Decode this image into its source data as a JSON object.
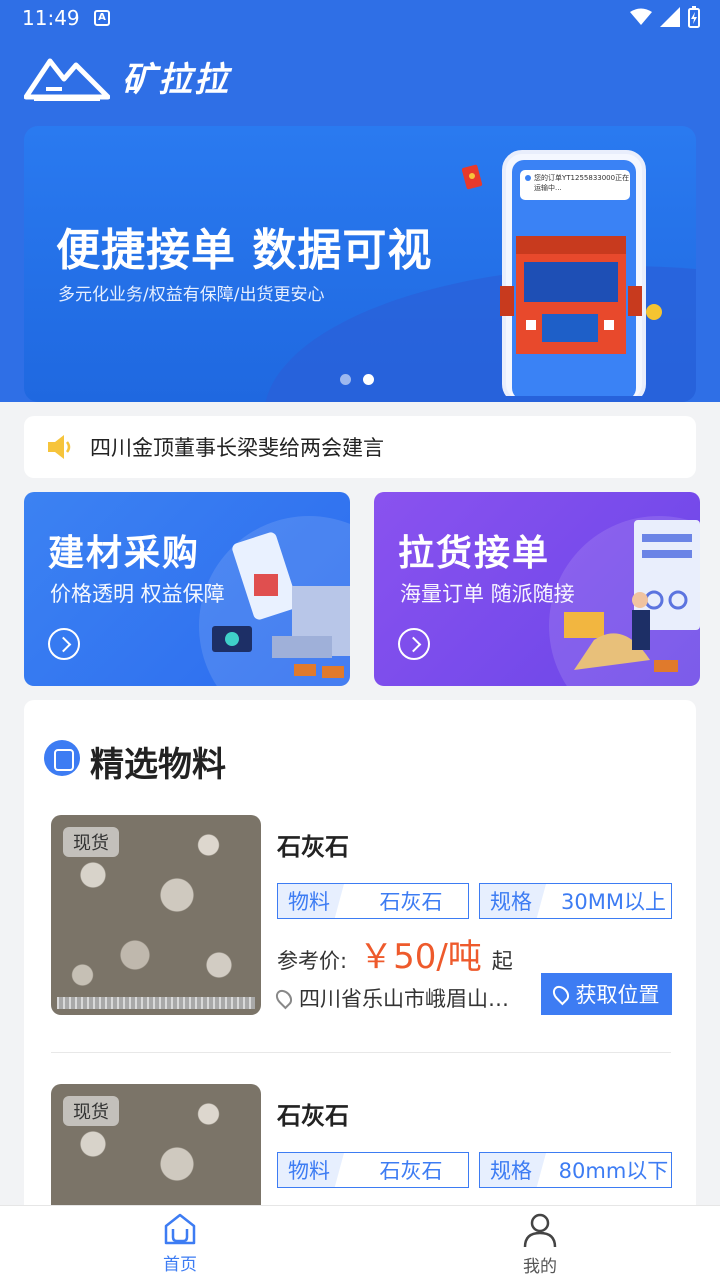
{
  "status_bar": {
    "time": "11:49",
    "notif_letter": "A"
  },
  "header": {
    "brand": "矿拉拉"
  },
  "banner": {
    "title": "便捷接单 数据可视",
    "subtitle": "多元化业务/权益有保障/出货更安心",
    "phone_notice": "您的订单YT1255833000正在运输中...",
    "slides": 2,
    "active_slide": 2
  },
  "notice": {
    "text": "四川金顶董事长梁斐给两会建言"
  },
  "cards": [
    {
      "title": "建材采购",
      "subtitle": "价格透明 权益保障"
    },
    {
      "title": "拉货接单",
      "subtitle": "海量订单 随派随接"
    }
  ],
  "featured": {
    "title": "精选物料",
    "products": [
      {
        "stock": "现货",
        "name": "石灰石",
        "material_key": "物料",
        "material_val": "石灰石",
        "spec_key": "规格",
        "spec_val": "30MM以上",
        "price_label": "参考价:",
        "price": "￥50/吨",
        "price_suffix": "起",
        "location": "四川省乐山市峨眉山…",
        "location_btn": "获取位置"
      },
      {
        "stock": "现货",
        "name": "石灰石",
        "material_key": "物料",
        "material_val": "石灰石",
        "spec_key": "规格",
        "spec_val": "80mm以下"
      }
    ]
  },
  "tabbar": {
    "home": "首页",
    "mine": "我的"
  },
  "colors": {
    "primary": "#2f6fe6",
    "price": "#ee5a2c",
    "accent_purple": "#7a4cec"
  }
}
